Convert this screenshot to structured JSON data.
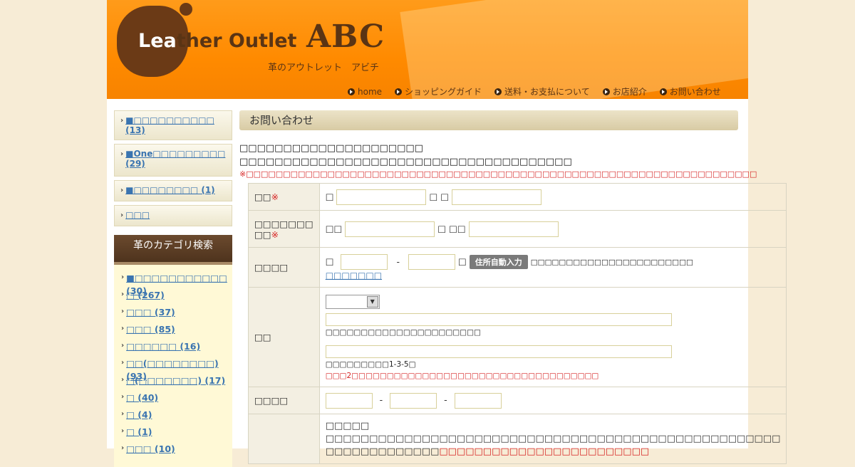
{
  "header": {
    "logo_main_light": "Lea",
    "logo_main_dark": "ther Outlet",
    "logo_abc": "ABC",
    "logo_sub": "革のアウトレット　アビチ",
    "nav": [
      "home",
      "ショッピングガイド",
      "送料・お支払について",
      "お店紹介",
      "お問い合わせ"
    ]
  },
  "sidebar": {
    "buttons": [
      "■□□□□□□□□□□ (13)",
      "■One□□□□□□□□□",
      "(29)",
      "■□□□□□□□□ (1)",
      "□□□"
    ],
    "category_heading": "革のカテゴリ検索",
    "categories": [
      "■□□□□□□□□□□□ (30)",
      "□ (267)",
      "□□□ (37)",
      "□□□ (85)",
      "□□□□□□ (16)",
      "□□(□□□□□□□□) (93)",
      "□(□□□□□□□) (17)",
      "□ (40)",
      "□ (4)",
      "□ (1)",
      "□□□ (10)"
    ]
  },
  "main": {
    "title": "お問い合わせ",
    "intro_line1": "□□□□□□□□□□□□□□□□□□□□□",
    "intro_line2": "□□□□□□□□□□□□□□□□□□□□□□□□□□□□□□□□□□□□□□",
    "intro_note": "※□□□□□□□□□□□□□□□□□□□□□□□□□□□□□□□□□□□□□□□□□□□□□□□□□□□□□□□□□□□□□□□□□□□□□",
    "req_mark": "※",
    "rows": {
      "name_label": "□□",
      "name_prefix1": "□",
      "name_prefix2": "□ □",
      "kana_label_line1": "□□□□□□□",
      "kana_label_line2": "□□",
      "kana_prefix1": "□□",
      "kana_prefix2": "□ □□",
      "zip_label": "□□□□",
      "zip_prefix": "□",
      "zip_dash": "-",
      "zip_suffix": "□",
      "auto_button": "住所自動入力",
      "zip_note": "□□□□□□□□□□□□□□□□□□□□□□□",
      "zip_link": "□□□□□□□",
      "addr_label": "□□",
      "addr_note1": "□□□□□□□□□□□□□□□□□□□□□□",
      "addr_note2": "□□□□□□□□□1-3-5□",
      "addr_note3": "□□□2□□□□□□□□□□□□□□□□□□□□□□□□□□□□□□□□□□□",
      "tel_label": "□□□□",
      "tel_dash": "-",
      "inq_heading": "□□□□□",
      "inq_line1": "□□□□□□□□□□□□□□□□□□□□□□□□□□□□□□□□□□□□□□□□□□□□□□□□□□□□",
      "inq_line2_black": "□□□□□□□□□□□□□",
      "inq_line2_red": "□□□□□□□□□□□□□□□□□□□□□□□□"
    }
  }
}
